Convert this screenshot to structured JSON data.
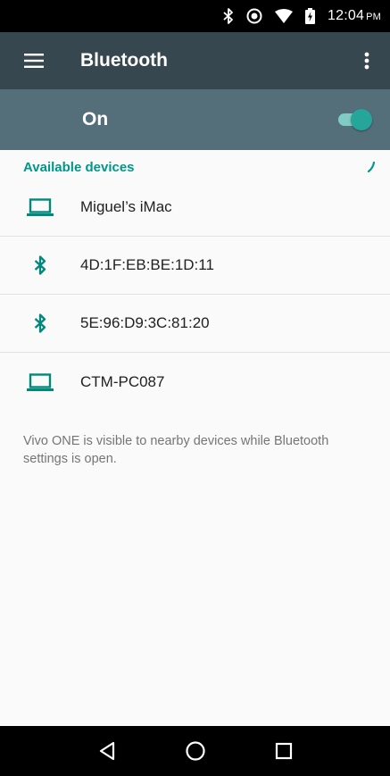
{
  "status_bar": {
    "time": "12:04",
    "ampm": "PM",
    "icons": [
      "bluetooth-icon",
      "do-not-disturb-icon",
      "wifi-icon",
      "battery-icon"
    ]
  },
  "toolbar": {
    "title": "Bluetooth",
    "menu_icon": "hamburger-menu-icon",
    "more_icon": "more-vert-icon"
  },
  "switch_bar": {
    "label": "On",
    "state": true
  },
  "section": {
    "title": "Available devices"
  },
  "devices": [
    {
      "name": "Miguel’s iMac",
      "icon": "laptop-icon"
    },
    {
      "name": "4D:1F:EB:BE:1D:11",
      "icon": "bluetooth-icon"
    },
    {
      "name": "5E:96:D9:3C:81:20",
      "icon": "bluetooth-icon"
    },
    {
      "name": "CTM-PC087",
      "icon": "laptop-icon"
    }
  ],
  "info_text": "Vivo ONE is visible to nearby devices while Bluetooth settings is open.",
  "nav_bar": {
    "buttons": [
      "back-icon",
      "home-icon",
      "recents-icon"
    ]
  },
  "colors": {
    "toolbar": "#37474f",
    "switch_bar": "#546e7a",
    "accent": "#009688",
    "icon_teal": "#00897b",
    "background": "#fafafa"
  }
}
